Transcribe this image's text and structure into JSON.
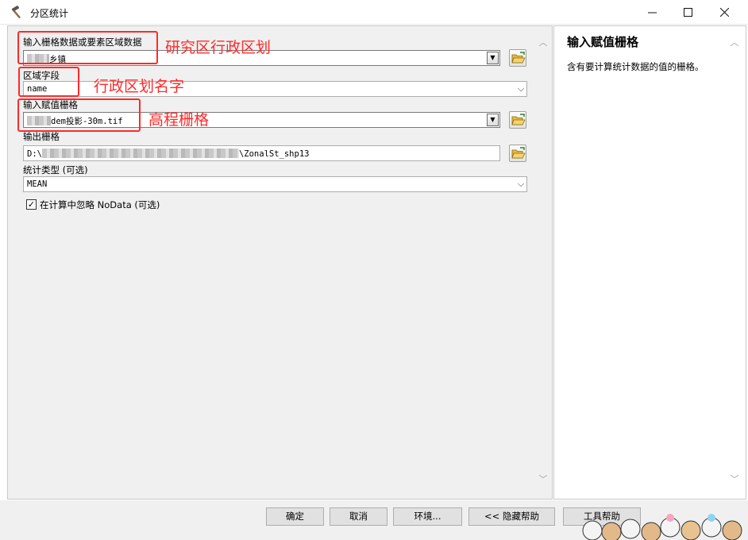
{
  "window": {
    "title": "分区统计",
    "min_icon": "minimize-icon",
    "max_icon": "maximize-icon",
    "close_icon": "close-icon"
  },
  "form": {
    "input_zone": {
      "label": "输入栅格数据或要素区域数据",
      "value": "乡镇"
    },
    "zone_field": {
      "label": "区域字段",
      "value": "name"
    },
    "value_raster": {
      "label": "输入赋值栅格",
      "value": "dem投影-30m.tif"
    },
    "output_raster": {
      "label": "输出栅格",
      "value_prefix": "D:\\",
      "value_suffix": "\\ZonalSt_shp13"
    },
    "statistics_type": {
      "label": "统计类型 (可选)",
      "value": "MEAN"
    },
    "ignore_nodata": {
      "label": "在计算中忽略 NoData (可选)",
      "checked": true
    }
  },
  "annotations": {
    "a1": "研究区行政区划",
    "a2": "行政区划名字",
    "a3": "高程栅格",
    "color": "#ff2a2a"
  },
  "help": {
    "title": "输入赋值栅格",
    "body": "含有要计算统计数据的值的栅格。"
  },
  "buttons": {
    "ok": "确定",
    "cancel": "取消",
    "env": "环境...",
    "hide_help": "<< 隐藏帮助",
    "tool_help": "工具帮助"
  }
}
